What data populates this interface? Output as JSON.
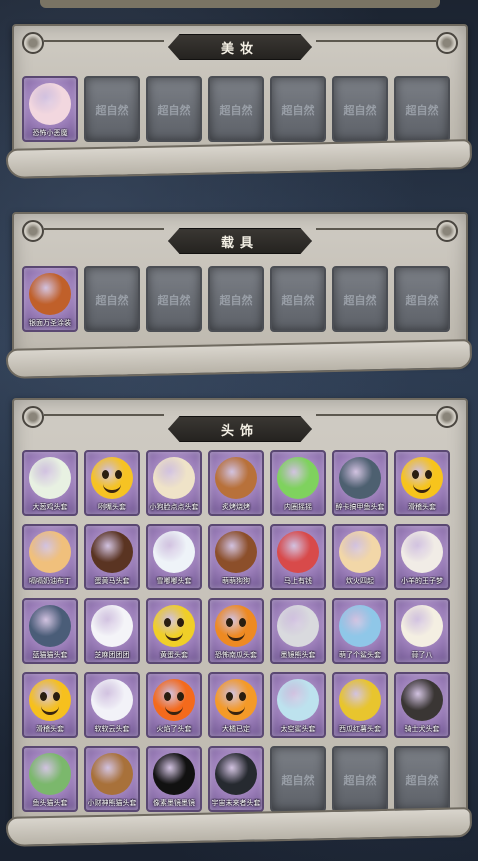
{
  "watermark": "超自然",
  "sections": [
    {
      "title": "美妆",
      "items": [
        {
          "name": "恐怖小恶魔",
          "icon": "devil-girl-icon",
          "color": "#f2d7df"
        },
        null,
        null,
        null,
        null,
        null,
        null
      ]
    },
    {
      "title": "载具",
      "items": [
        {
          "name": "银面万圣涂装",
          "icon": "halloween-truck-icon",
          "color": "#c0602a"
        },
        null,
        null,
        null,
        null,
        null,
        null
      ]
    },
    {
      "title": "头饰",
      "items": [
        {
          "name": "大葱鸡头套",
          "icon": "scallion-head-icon",
          "color": "#e8f1e2"
        },
        {
          "name": "咧嘴头套",
          "icon": "grin-emoji-icon",
          "color": "#f6c323"
        },
        {
          "name": "小狗脸点点头套",
          "icon": "dog-face-icon",
          "color": "#efe3c8"
        },
        {
          "name": "炙烤烧烤",
          "icon": "toast-icon",
          "color": "#b8713a"
        },
        {
          "name": "内圈摇摇",
          "icon": "green-blob-icon",
          "color": "#7fd25e"
        },
        {
          "name": "醉卡搞甲鱼头套",
          "icon": "seal-head-icon",
          "color": "#4d6070"
        },
        {
          "name": "滑稽头套",
          "icon": "funny-face-icon",
          "color": "#f7c41c"
        },
        {
          "name": "嗝嗝奶油布丁",
          "icon": "pudding-icon",
          "color": "#f0c07c"
        },
        {
          "name": "蛋黄马头套",
          "icon": "horse-head-icon",
          "color": "#5a3422"
        },
        {
          "name": "雪嘟嘟头套",
          "icon": "snowman-icon",
          "color": "#eef3f8"
        },
        {
          "name": "萌萌狗狗",
          "icon": "dog-head-icon",
          "color": "#8c4f2a"
        },
        {
          "name": "马上有钱",
          "icon": "red-horse-icon",
          "color": "#d84a4a"
        },
        {
          "name": "炊火四起",
          "icon": "candle-icon",
          "color": "#f2d7a8"
        },
        {
          "name": "小羊的王子梦",
          "icon": "lamb-icon",
          "color": "#f1ece6"
        },
        {
          "name": "蓝猫猫头套",
          "icon": "blue-cat-icon",
          "color": "#4a5d78"
        },
        {
          "name": "芝麻团团团",
          "icon": "dumpling-icon",
          "color": "#f4f4f8"
        },
        {
          "name": "黄蛋头套",
          "icon": "yellow-ball-icon",
          "color": "#f0cf28"
        },
        {
          "name": "恐怖南瓜头套",
          "icon": "pumpkin-icon",
          "color": "#ee8a22"
        },
        {
          "name": "墨镜熊头套",
          "icon": "bear-sunglasses-icon",
          "color": "#d9dade"
        },
        {
          "name": "萌了个鲨头套",
          "icon": "shark-head-icon",
          "color": "#8fc7e8"
        },
        {
          "name": "蒜了八",
          "icon": "garlic-icon",
          "color": "#f4efe2"
        },
        {
          "name": "滑稽头套",
          "icon": "smile-emoji-icon",
          "color": "#f6c01e"
        },
        {
          "name": "软软云头套",
          "icon": "cloud-head-icon",
          "color": "#f2f2f8"
        },
        {
          "name": "火焰了头套",
          "icon": "fire-spirit-icon",
          "color": "#f46a1c"
        },
        {
          "name": "大橘已定",
          "icon": "orange-icon",
          "color": "#f49a28"
        },
        {
          "name": "太空鲨头套",
          "icon": "space-shark-icon",
          "color": "#bde2ee"
        },
        {
          "name": "西瓜红薯头套",
          "icon": "pikachu-icon",
          "color": "#e8c52e"
        },
        {
          "name": "骑士犬头套",
          "icon": "doberman-icon",
          "color": "#3a3634"
        },
        {
          "name": "鱼头猫头套",
          "icon": "fish-head-icon",
          "color": "#7bb86c"
        },
        {
          "name": "小财神熊猫头套",
          "icon": "poop-god-icon",
          "color": "#a8713a"
        },
        {
          "name": "像素墨镜墨镜",
          "icon": "pixel-sunglasses-icon",
          "color": "#111111"
        },
        {
          "name": "宇宙未来者头套",
          "icon": "astronaut-helmet-icon",
          "color": "#262a30"
        },
        null,
        null,
        null
      ]
    }
  ]
}
